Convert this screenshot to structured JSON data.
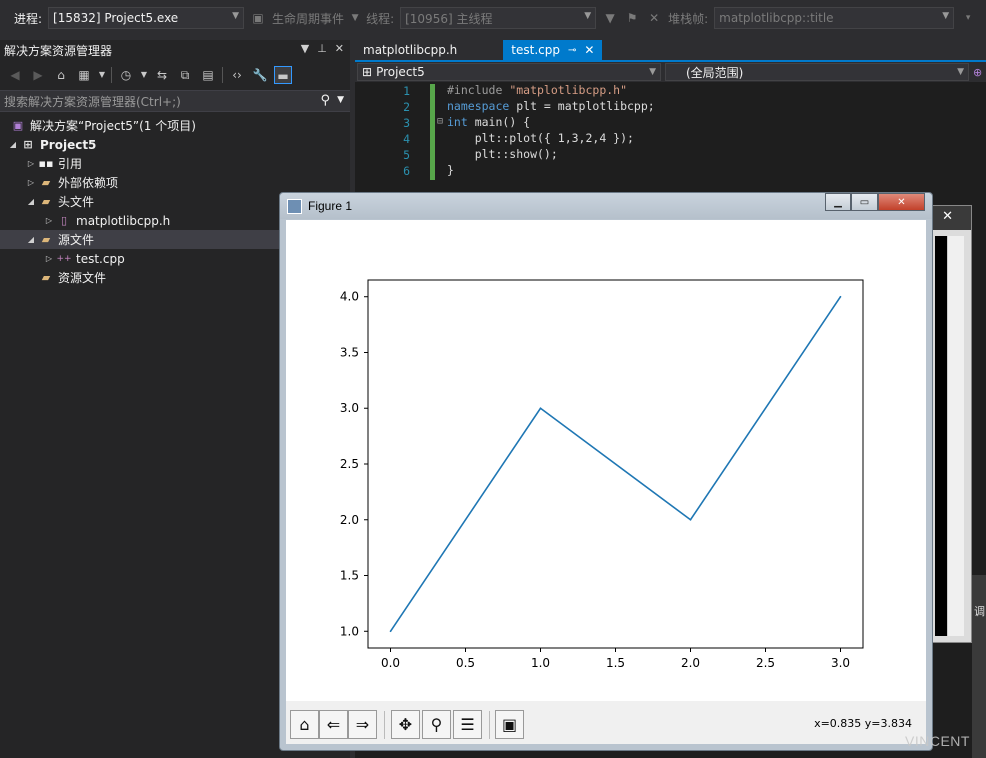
{
  "toolbar": {
    "process_label": "进程:",
    "process_value": "[15832] Project5.exe",
    "lifecycle_label": "生命周期事件",
    "thread_label": "线程:",
    "thread_value": "[10956] 主线程",
    "stack_label": "堆栈帧:",
    "stack_value": "matplotlibcpp::title"
  },
  "solution_explorer": {
    "title": "解决方案资源管理器",
    "search_placeholder": "搜索解决方案资源管理器(Ctrl+;)",
    "tree": {
      "solution": "解决方案“Project5”(1 个项目)",
      "project": "Project5",
      "references": "引用",
      "external_deps": "外部依赖项",
      "headers": "头文件",
      "header_file": "matplotlibcpp.h",
      "sources": "源文件",
      "source_file": "test.cpp",
      "resources": "资源文件"
    }
  },
  "editor": {
    "tabs": [
      {
        "label": "matplotlibcpp.h"
      },
      {
        "label": "test.cpp"
      }
    ],
    "nav_project": "Project5",
    "nav_scope": "(全局范围)",
    "lines": [
      {
        "num": "1",
        "pre": "#include ",
        "str": "\"matplotlibcpp.h\"",
        "post": ""
      },
      {
        "num": "2",
        "kw": "namespace",
        "post": " plt = matplotlibcpp;"
      },
      {
        "num": "3",
        "kw": "int",
        "post": " main() {"
      },
      {
        "num": "4",
        "post": "    plt::plot({ 1,3,2,4 });"
      },
      {
        "num": "5",
        "post": "    plt::show();"
      },
      {
        "num": "6",
        "post": "}"
      }
    ]
  },
  "figure": {
    "title": "Figure 1",
    "coords": "x=0.835 y=3.834",
    "buttons": [
      "home-icon",
      "back-icon",
      "forward-icon",
      "pan-icon",
      "zoom-icon",
      "configure-icon",
      "save-icon"
    ]
  },
  "console": {
    "close": "✕"
  },
  "right_panel_text": "调",
  "watermark": "VINCENT",
  "chart_data": {
    "type": "line",
    "x": [
      0,
      1,
      2,
      3
    ],
    "series": [
      {
        "values": [
          1,
          3,
          2,
          4
        ],
        "color": "#1f77b4"
      }
    ],
    "xticks": [
      "0.0",
      "0.5",
      "1.0",
      "1.5",
      "2.0",
      "2.5",
      "3.0"
    ],
    "yticks": [
      "1.0",
      "1.5",
      "2.0",
      "2.5",
      "3.0",
      "3.5",
      "4.0"
    ],
    "xlim": [
      -0.15,
      3.15
    ],
    "ylim": [
      0.85,
      4.15
    ],
    "grid": false
  }
}
